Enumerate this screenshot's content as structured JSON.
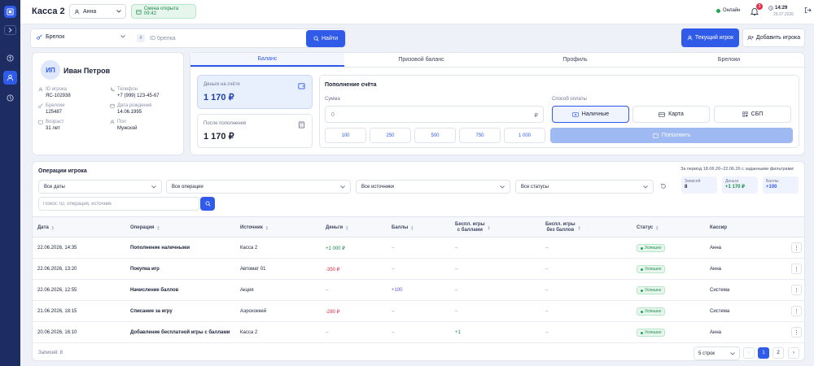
{
  "header": {
    "title": "Касса 2",
    "user": "Анна",
    "shift": "Смена открыта 09:42",
    "online": "Онлайн",
    "notifications": "3",
    "time": "14:29",
    "date": "29.07.2026"
  },
  "search": {
    "type": "Брелок",
    "hash": "#",
    "placeholder": "ID брелка",
    "button": "Найти"
  },
  "actions": {
    "current_player": "Текущий игрок",
    "add_player": "Добавить игрока"
  },
  "profile": {
    "initials": "ИП",
    "name": "Иван Петров",
    "id_label": "ID игрока",
    "id_value": "ЯС-102938",
    "phone_label": "Телефон",
    "phone_value": "+7 (999) 123-45-67",
    "keys_label": "Брелоки",
    "keys_value": "125487",
    "birth_label": "Дата рождения",
    "birth_value": "14.06.1995",
    "age_label": "Возраст",
    "age_value": "31 лет",
    "gender_label": "Пол",
    "gender_value": "Мужской"
  },
  "tabs": [
    "Баланс",
    "Призовой баланс",
    "Профиль",
    "Брелоки"
  ],
  "balance": {
    "money_label": "Деньги на счёте",
    "money_value": "1 170 ₽",
    "after_label": "После пополнения",
    "after_value": "1 170 ₽"
  },
  "topup": {
    "title": "Пополнение счёта",
    "sum_label": "Сумма",
    "sum_value": "0",
    "currency": "₽",
    "amounts": [
      "100",
      "250",
      "500",
      "750",
      "1 000"
    ],
    "method_label": "Способ оплаты",
    "methods": [
      "Наличные",
      "Карта",
      "СБП"
    ],
    "submit": "Пополнить"
  },
  "operations": {
    "title": "Операции игрока",
    "filters": [
      "Все даты",
      "Все операции",
      "Все источники",
      "Все статусы"
    ],
    "search_placeholder": "Поиск: ID, операция, источник",
    "period": "За период 18.06.26–22.06.26 с заданными фильтрами:",
    "stats": [
      {
        "label": "Записей",
        "value": "8"
      },
      {
        "label": "Деньги",
        "value": "+1 170 ₽"
      },
      {
        "label": "Баллы",
        "value": "+100"
      }
    ],
    "columns": [
      "Дата",
      "Операция",
      "Источник",
      "Деньги",
      "Баллы",
      "Беспл. игры\nс баллами",
      "Беспл. игры\nбез баллов",
      "Статус",
      "Кассир"
    ],
    "rows": [
      {
        "date": "22.06.2026, 14:35",
        "op": "Пополнение наличными",
        "source": "Касса 2",
        "money": "+1 000 ₽",
        "points": "–",
        "free_with": "–",
        "free_without": "–",
        "status": "Успешно",
        "cashier": "Анна"
      },
      {
        "date": "22.06.2026, 13:20",
        "op": "Покупка игр",
        "source": "Автомат 01",
        "money": "-350 ₽",
        "points": "–",
        "free_with": "–",
        "free_without": "–",
        "status": "Успешно",
        "cashier": "Анна"
      },
      {
        "date": "22.06.2026, 12:55",
        "op": "Начисление баллов",
        "source": "Акция",
        "money": "–",
        "points": "+100",
        "free_with": "–",
        "free_without": "–",
        "status": "Успешно",
        "cashier": "Система"
      },
      {
        "date": "21.06.2026, 18:15",
        "op": "Списание за игру",
        "source": "Аэрохоккей",
        "money": "-280 ₽",
        "points": "–",
        "free_with": "–",
        "free_without": "–",
        "status": "Успешно",
        "cashier": "Система"
      },
      {
        "date": "20.06.2026, 16:10",
        "op": "Добавление бесплатной игры с баллами",
        "source": "Касса 2",
        "money": "–",
        "points": "–",
        "free_with": "+1",
        "free_without": "–",
        "status": "Успешно",
        "cashier": "Анна"
      }
    ],
    "records_footer": "Записей: 8",
    "page_size": "5 строк",
    "pages": [
      "1",
      "2"
    ]
  }
}
